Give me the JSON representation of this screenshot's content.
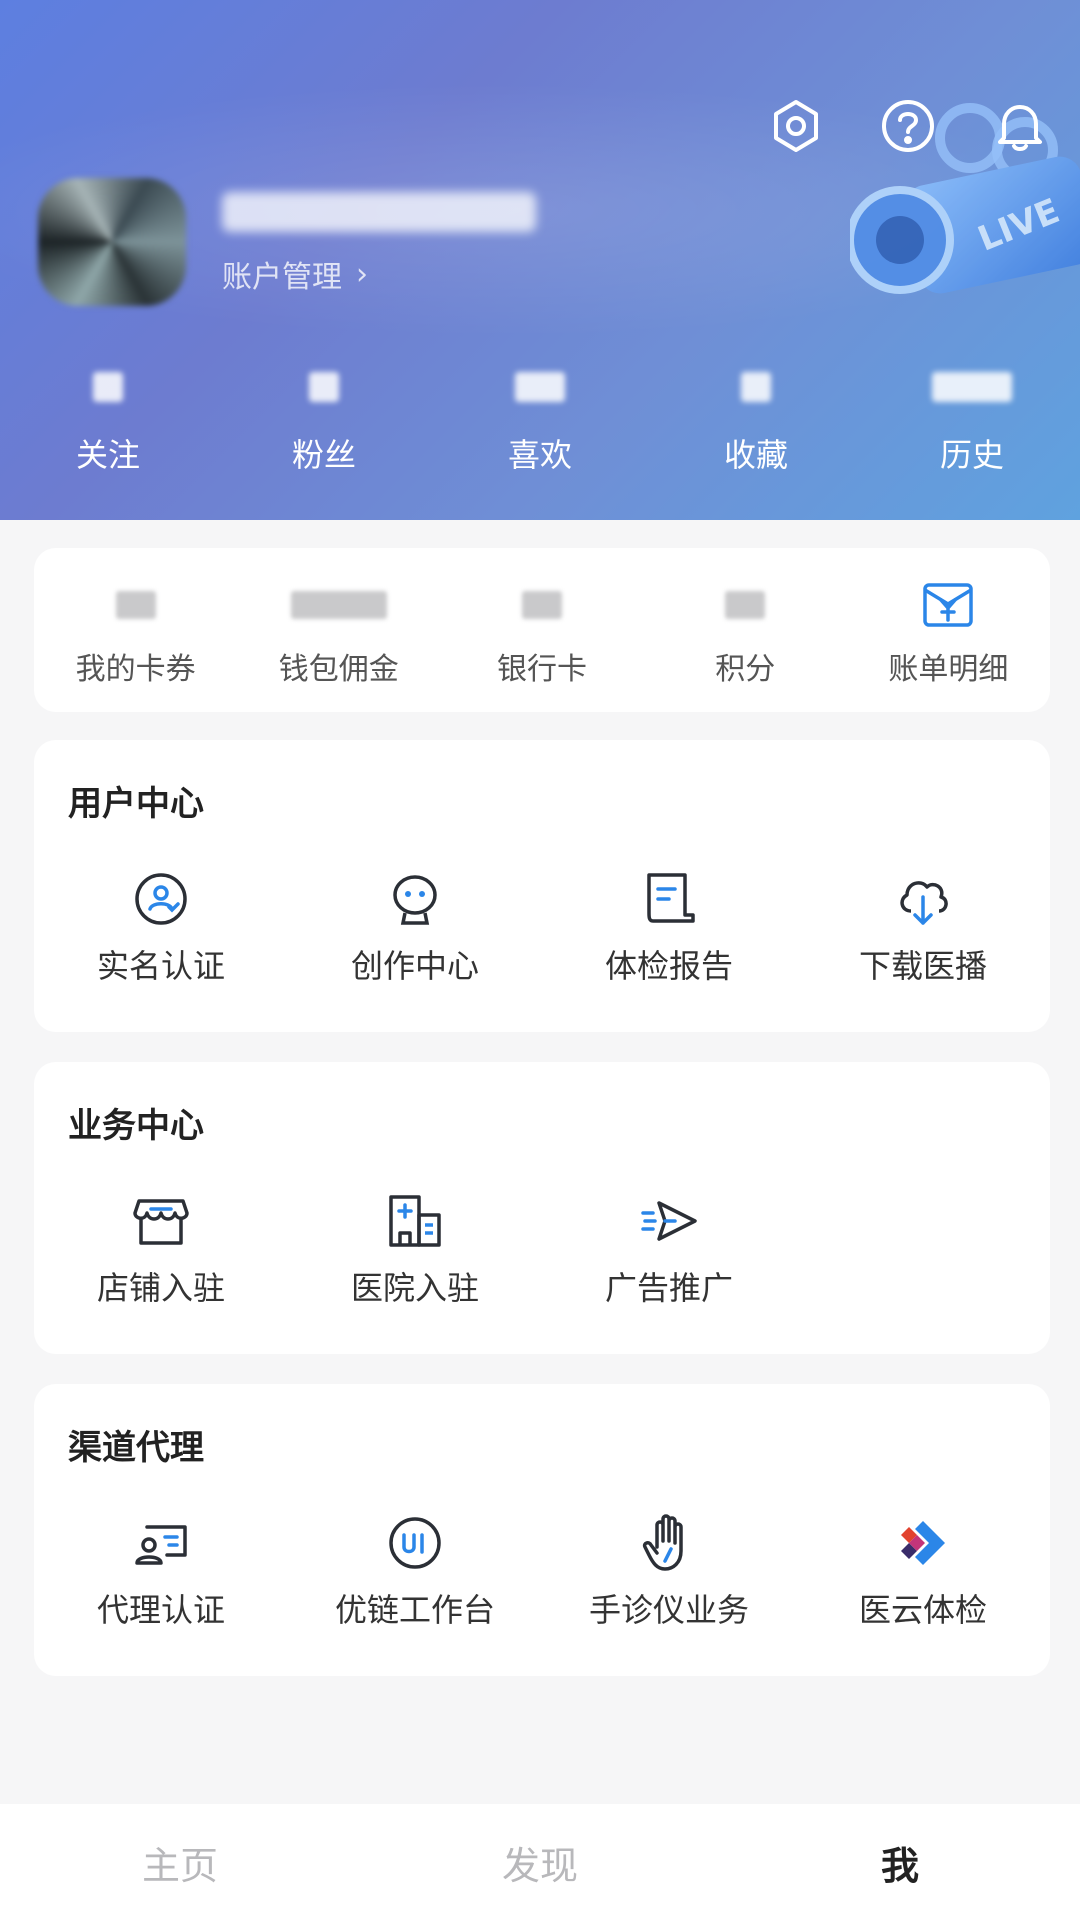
{
  "header": {
    "account_manage_label": "账户管理",
    "stats": [
      {
        "label": "关注"
      },
      {
        "label": "粉丝"
      },
      {
        "label": "喜欢"
      },
      {
        "label": "收藏"
      },
      {
        "label": "历史"
      }
    ],
    "top_icons": [
      "settings-icon",
      "help-icon",
      "bell-icon"
    ],
    "gradient_colors": [
      "#5d7fe0",
      "#6d7cd0",
      "#5fa2df"
    ]
  },
  "wallet": {
    "items": [
      {
        "label": "我的卡券"
      },
      {
        "label": "钱包佣金"
      },
      {
        "label": "银行卡"
      },
      {
        "label": "积分"
      },
      {
        "label": "账单明细",
        "icon": "bill-icon"
      }
    ]
  },
  "user_center": {
    "title": "用户中心",
    "items": [
      {
        "label": "实名认证",
        "icon": "verify-icon"
      },
      {
        "label": "创作中心",
        "icon": "creator-icon"
      },
      {
        "label": "体检报告",
        "icon": "report-icon"
      },
      {
        "label": "下载医播",
        "icon": "cloud-download-icon"
      }
    ]
  },
  "business_center": {
    "title": "业务中心",
    "items": [
      {
        "label": "店铺入驻",
        "icon": "store-icon"
      },
      {
        "label": "医院入驻",
        "icon": "hospital-icon"
      },
      {
        "label": "广告推广",
        "icon": "send-icon"
      }
    ]
  },
  "channel_agent": {
    "title": "渠道代理",
    "items": [
      {
        "label": "代理认证",
        "icon": "agent-card-icon"
      },
      {
        "label": "优链工作台",
        "icon": "ui-icon"
      },
      {
        "label": "手诊仪业务",
        "icon": "hand-icon"
      },
      {
        "label": "医云体检",
        "icon": "arrows-logo-icon"
      }
    ]
  },
  "tabbar": {
    "tabs": [
      {
        "label": "主页"
      },
      {
        "label": "发现"
      },
      {
        "label": "我"
      }
    ],
    "active_index": 2
  },
  "colors": {
    "accent": "#2b86e8",
    "icon_dark": "#2b2f36"
  }
}
